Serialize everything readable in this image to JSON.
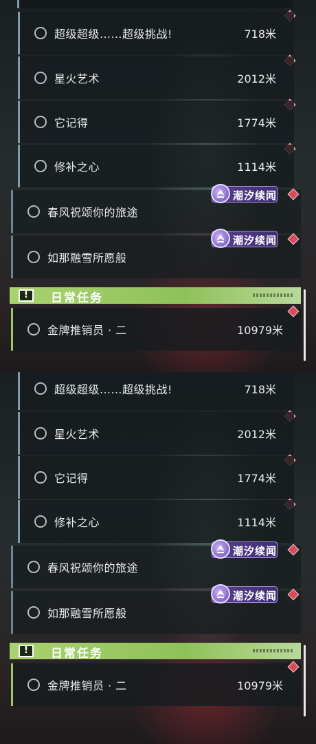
{
  "quests": [
    {
      "title": "超级超级……超级挑战!",
      "distance": "718米"
    },
    {
      "title": "星火艺术",
      "distance": "2012米"
    },
    {
      "title": "它记得",
      "distance": "1774米"
    },
    {
      "title": "修补之心",
      "distance": "1114米"
    }
  ],
  "side_quests": [
    {
      "title": "春风祝颂你的旅途",
      "tag": "潮汐续闻"
    },
    {
      "title": "如那融雪所愿般",
      "tag": "潮汐续闻"
    }
  ],
  "daily_section": {
    "title": "日常任务",
    "icon": "alert-icon"
  },
  "daily_quests": [
    {
      "title": "金牌推销员 · 二",
      "distance": "10979米"
    }
  ],
  "colors": {
    "marker": "#d94a5a",
    "tag": "#5a3f8e",
    "daily": "#9cc764",
    "accent": "#7e9aa6"
  }
}
